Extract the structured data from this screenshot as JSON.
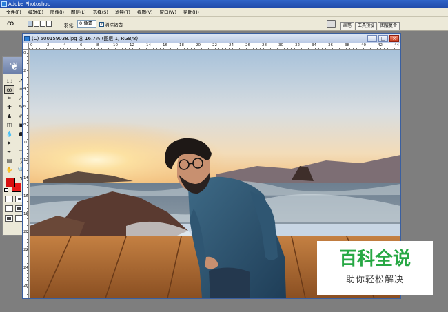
{
  "app": {
    "title": "Adobe Photoshop"
  },
  "menu": [
    {
      "label": "文件(F)"
    },
    {
      "label": "编辑(E)"
    },
    {
      "label": "图像(I)"
    },
    {
      "label": "图层(L)"
    },
    {
      "label": "选择(S)"
    },
    {
      "label": "滤镜(T)"
    },
    {
      "label": "视图(V)"
    },
    {
      "label": "窗口(W)"
    },
    {
      "label": "帮助(H)"
    }
  ],
  "options": {
    "tool_icon": "lasso-icon",
    "feather_label": "羽化:",
    "feather_value": "0 像素",
    "antialias_label": "消除锯齿",
    "antialias_checked": true
  },
  "palette_tabs": [
    {
      "label": "画笔"
    },
    {
      "label": "工具预设"
    },
    {
      "label": "图层复合"
    }
  ],
  "document": {
    "title": "(C) 500159038.jpg @ 16.7% (图层 1, RGB/8)",
    "zoom": "16.7%",
    "hruler_ticks": [
      "0",
      "2",
      "4",
      "6",
      "8",
      "10",
      "12",
      "14",
      "16",
      "18",
      "20",
      "22",
      "24",
      "26",
      "28",
      "30",
      "32",
      "34",
      "36",
      "38",
      "40",
      "42",
      "44"
    ],
    "vruler_ticks": [
      "0",
      "2",
      "4",
      "6",
      "8",
      "10",
      "12",
      "14",
      "16",
      "18",
      "20",
      "22",
      "24",
      "26"
    ]
  },
  "colors": {
    "foreground": "#d81010",
    "background": "#e81818",
    "titlebar": "#2f64c8",
    "watermark_green": "#27a844"
  },
  "watermark": {
    "main": "百科全说",
    "sub": "助你轻松解决"
  }
}
